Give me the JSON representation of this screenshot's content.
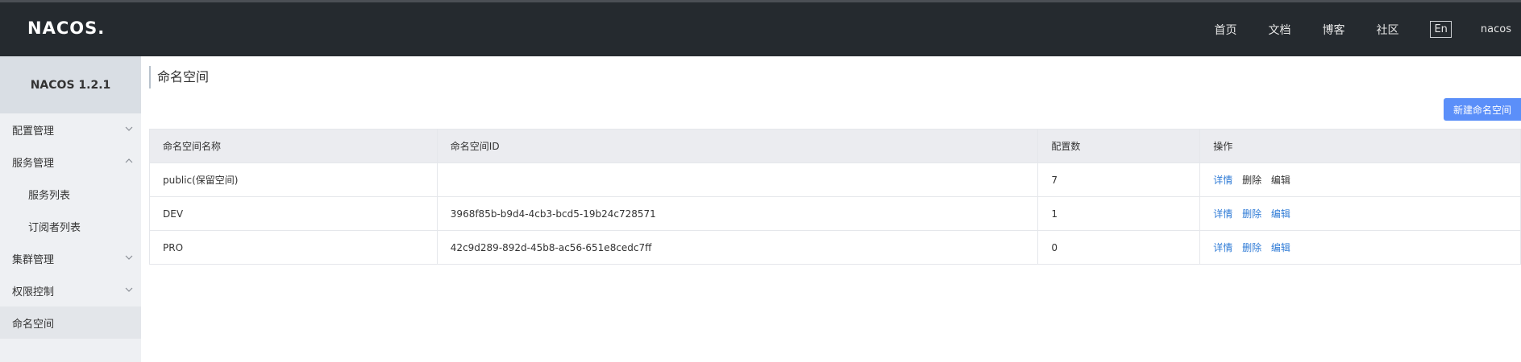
{
  "header": {
    "logo": "NACOS.",
    "nav": [
      "首页",
      "文档",
      "博客",
      "社区"
    ],
    "lang": "En",
    "user": "nacos"
  },
  "sidebar": {
    "title": "NACOS 1.2.1",
    "items": [
      {
        "label": "配置管理",
        "chevron": "down"
      },
      {
        "label": "服务管理",
        "chevron": "up"
      },
      {
        "label": "服务列表",
        "sub": true
      },
      {
        "label": "订阅者列表",
        "sub": true
      },
      {
        "label": "集群管理",
        "chevron": "down"
      },
      {
        "label": "权限控制",
        "chevron": "down"
      },
      {
        "label": "命名空间",
        "active": true
      }
    ]
  },
  "main": {
    "title": "命名空间",
    "new_button": "新建命名空间",
    "table": {
      "headers": [
        "命名空间名称",
        "命名空间ID",
        "配置数",
        "操作"
      ],
      "rows": [
        {
          "name": "public(保留空间)",
          "id": "",
          "count": "7",
          "ops": [
            "详情",
            "删除",
            "编辑"
          ]
        },
        {
          "name": "DEV",
          "id": "3968f85b-b9d4-4cb3-bcd5-19b24c728571",
          "count": "1",
          "ops": [
            "详情",
            "删除",
            "编辑"
          ]
        },
        {
          "name": "PRO",
          "id": "42c9d289-892d-45b8-ac56-651e8cedc7ff",
          "count": "0",
          "ops": [
            "详情",
            "删除",
            "编辑"
          ]
        }
      ]
    }
  },
  "colors": {
    "header_bg": "#252a2f",
    "primary": "#5b8ff9",
    "link": "#2f7bd6"
  }
}
